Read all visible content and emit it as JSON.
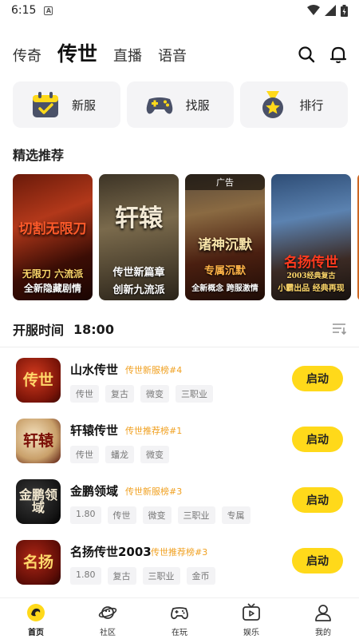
{
  "status_bar": {
    "time": "6:15",
    "badge": "A"
  },
  "top_tabs": [
    {
      "label": "传奇",
      "active": false
    },
    {
      "label": "传世",
      "active": true
    },
    {
      "label": "直播",
      "active": false
    },
    {
      "label": "语音",
      "active": false
    }
  ],
  "quick_actions": [
    {
      "label": "新服",
      "icon": "calendar-check-icon"
    },
    {
      "label": "找服",
      "icon": "gamepad-icon"
    },
    {
      "label": "排行",
      "icon": "medal-star-icon"
    }
  ],
  "featured": {
    "title": "精选推荐",
    "banners": [
      {
        "main": "切割无限刀",
        "sub1": "无限刀 六流派",
        "sub2": "全新隐藏剧情",
        "ad": ""
      },
      {
        "main": "轩辕",
        "sub1": "传世新篇章",
        "sub2": "创新九流派",
        "ad": ""
      },
      {
        "main": "诸神沉默",
        "sub1": "专属沉默",
        "sub2": "全新概念 跨服激情",
        "ad": "广告"
      },
      {
        "main": "名扬传世",
        "sub1": "2003经典复古",
        "sub2": "小霸出品 经典再现",
        "ad": ""
      }
    ]
  },
  "open_server": {
    "label": "开服时间",
    "time": "18:00"
  },
  "games": [
    {
      "name": "山水传世",
      "rank": "传世新服榜#4",
      "tags": [
        "传世",
        "复古",
        "微变",
        "三职业"
      ],
      "icon_text": "传世",
      "launch": "启动"
    },
    {
      "name": "轩辕传世",
      "rank": "传世推荐榜#1",
      "tags": [
        "传世",
        "蟠龙",
        "微变"
      ],
      "icon_text": "轩辕",
      "launch": "启动"
    },
    {
      "name": "金鹏领域",
      "rank": "传世新服榜#3",
      "tags": [
        "1.80",
        "传世",
        "微变",
        "三职业",
        "专属"
      ],
      "icon_text": "金鹏领域",
      "launch": "启动"
    },
    {
      "name": "名扬传世2003",
      "rank": "传世推荐榜#3",
      "tags": [
        "1.80",
        "复古",
        "三职业",
        "金币"
      ],
      "icon_text": "名扬",
      "launch": "启动"
    }
  ],
  "bottom_nav": [
    {
      "label": "首页",
      "active": true
    },
    {
      "label": "社区",
      "active": false
    },
    {
      "label": "在玩",
      "active": false
    },
    {
      "label": "娱乐",
      "active": false
    },
    {
      "label": "我的",
      "active": false
    }
  ],
  "colors": {
    "accent": "#ffd91a",
    "rank": "#f0a020",
    "tag_bg": "#f3f3f5"
  }
}
